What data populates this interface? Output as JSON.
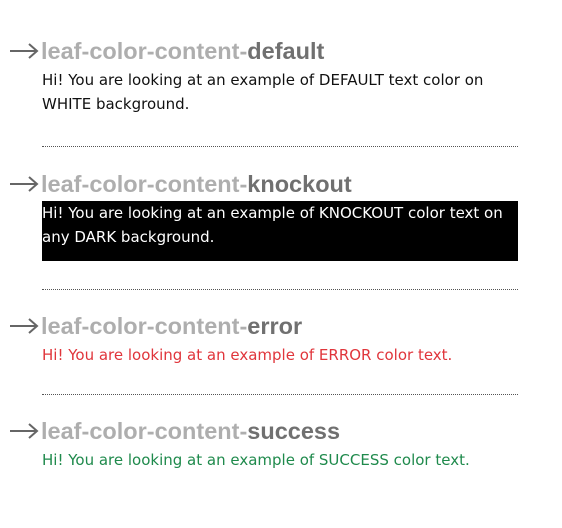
{
  "tokens": [
    {
      "prefix": "leaf-color-content-",
      "suffix": "default",
      "sample_text": "Hi! You are looking at an example of DEFAULT text color on WHITE background.",
      "text_color": "#111111",
      "background": "#ffffff"
    },
    {
      "prefix": "leaf-color-content-",
      "suffix": "knockout",
      "sample_text": "Hi! You are looking at an example of KNOCKOUT color text on any DARK background.",
      "text_color": "#ffffff",
      "background": "#000000"
    },
    {
      "prefix": "leaf-color-content-",
      "suffix": "error",
      "sample_text": "Hi! You are looking at an example of ERROR color text.",
      "text_color": "#e0353b",
      "background": "#ffffff"
    },
    {
      "prefix": "leaf-color-content-",
      "suffix": "success",
      "sample_text": "Hi! You are looking at an example of SUCCESS color text.",
      "text_color": "#1f8a4c",
      "background": "#ffffff"
    }
  ],
  "icons": {
    "heading_arrow": "arrow-right-icon"
  },
  "colors": {
    "title_prefix": "#aeaeae",
    "title_suffix": "#707070"
  }
}
